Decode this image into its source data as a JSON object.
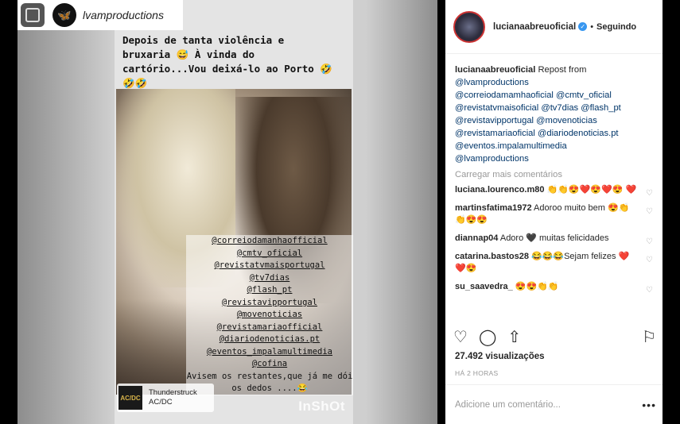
{
  "repost": {
    "account": "lvamproductions"
  },
  "story": {
    "caption": "Depois de tanta violência e bruxaria 😅 À vinda do cartório...Vou deixá-lo ao Porto 🤣🤣🤣",
    "tags": [
      "@correiodamanhaofficial",
      "@cmtv_oficial",
      "@revistatvmaisportugal",
      "@tv7dias",
      "@flash_pt",
      "@revistavipportugal",
      "@movenoticias",
      "@revistamariaofficial",
      "@diariodenoticias.pt",
      "@eventos_impalamultimedia",
      "@cofina"
    ],
    "note": "Avisem os restantes,que já me dói os dedos ....😂",
    "music": {
      "artwork": "AC/DC",
      "title": "Thunderstruck",
      "artist": "AC/DC"
    },
    "watermark": "InShOt"
  },
  "post": {
    "username": "lucianaabreuoficial",
    "follow_status": "Seguindo",
    "caption_user": "lucianaabreuoficial",
    "caption_text": " Repost from",
    "caption_lines": [
      "@lvamproductions",
      "@correiodamamhaoficial @cmtv_oficial",
      "@revistatvmaisoficial @tv7dias @flash_pt",
      "@revistavipportugal @movenoticias",
      "@revistamariaoficial @diariodenoticias.pt",
      "@eventos.impalamultimedia",
      "@lvamproductions"
    ],
    "load_more": "Carregar mais comentários",
    "comments": [
      {
        "user": "luciana.lourenco.m80",
        "text": " 👏👏😍❤️😍❤️😍 ❤️"
      },
      {
        "user": "martinsfatima1972",
        "text": " Adoroo muito bem 😍👏👏😍😍"
      },
      {
        "user": "diannap04",
        "text": " Adoro 🖤 muitas felicidades"
      },
      {
        "user": "catarina.bastos28",
        "text": " 😂😂😂Sejam felizes ❤️❤️😍"
      },
      {
        "user": "su_saavedra_",
        "text": " 😍😍👏👏"
      }
    ],
    "views": "27.492 visualizações",
    "date": "HÁ 2 HORAS",
    "add_comment_placeholder": "Adicione um comentário..."
  }
}
